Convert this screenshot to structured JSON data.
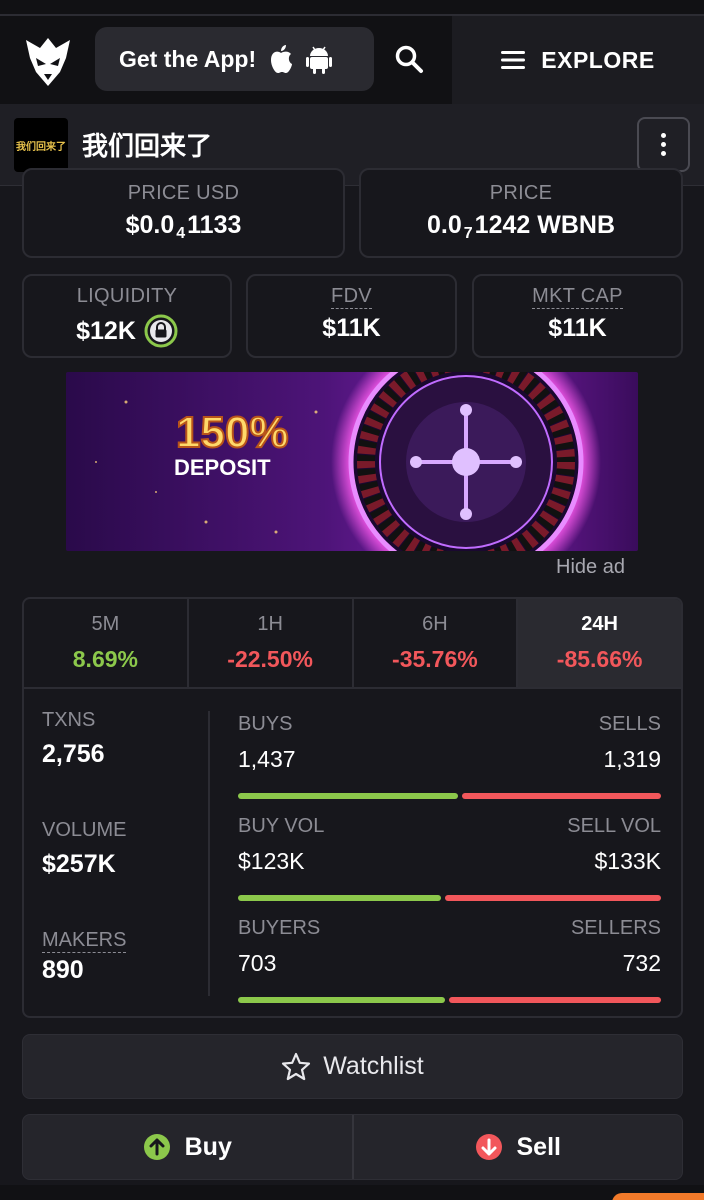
{
  "header": {
    "get_app_label": "Get the App!",
    "explore_label": "EXPLORE"
  },
  "token": {
    "name": "我们回来了",
    "image_text": "我们回来了"
  },
  "price_cards": {
    "price_usd": {
      "label": "PRICE USD",
      "prefix": "$0.0",
      "sub": "4",
      "suffix": "1133"
    },
    "price_native": {
      "label": "PRICE",
      "prefix": "0.0",
      "sub": "7",
      "suffix": "1242 WBNB"
    }
  },
  "metrics": {
    "liquidity": {
      "label": "LIQUIDITY",
      "value": "$12K"
    },
    "fdv": {
      "label": "FDV",
      "value": "$11K"
    },
    "mkt_cap": {
      "label": "MKT CAP",
      "value": "$11K"
    }
  },
  "ad": {
    "headline": "150%",
    "subtext": "DEPOSIT",
    "hide_label": "Hide ad"
  },
  "timeframes": [
    {
      "label": "5M",
      "change": "8.69%",
      "status_color": "#8cc84b"
    },
    {
      "label": "1H",
      "change": "-22.50%",
      "status_color": "#f2575b"
    },
    {
      "label": "6H",
      "change": "-35.76%",
      "status_color": "#f2575b"
    },
    {
      "label": "24H",
      "change": "-85.66%",
      "status_color": "#f2575b",
      "selected": true
    }
  ],
  "stats": {
    "txns": {
      "label": "TXNS",
      "value": "2,756"
    },
    "volume": {
      "label": "VOLUME",
      "value": "$257K"
    },
    "makers": {
      "label": "MAKERS",
      "value": "890"
    },
    "buys_sells": {
      "left_label": "BUYS",
      "right_label": "SELLS",
      "left_value": "1,437",
      "right_value": "1,319",
      "buy_fraction": 0.521
    },
    "buy_sell_vol": {
      "left_label": "BUY VOL",
      "right_label": "SELL VOL",
      "left_value": "$123K",
      "right_value": "$133K",
      "buy_fraction": 0.48
    },
    "buyers_sellers": {
      "left_label": "BUYERS",
      "right_label": "SELLERS",
      "left_value": "703",
      "right_value": "732",
      "buy_fraction": 0.49
    }
  },
  "actions": {
    "watchlist_label": "Watchlist",
    "buy_label": "Buy",
    "sell_label": "Sell"
  },
  "colors": {
    "positive": "#8cc84b",
    "negative": "#f2575b",
    "background": "#17171c"
  }
}
